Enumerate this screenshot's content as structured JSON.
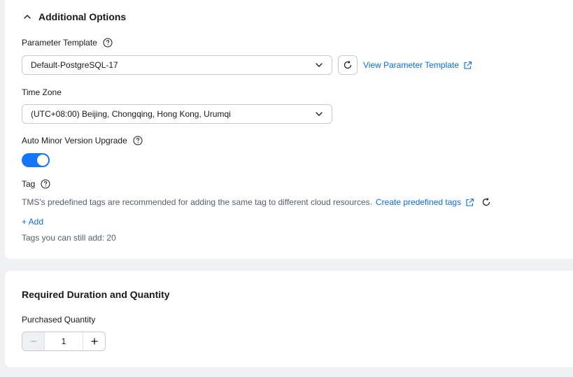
{
  "additional_options": {
    "title": "Additional Options",
    "parameter_template": {
      "label": "Parameter Template",
      "value": "Default-PostgreSQL-17",
      "view_link": "View Parameter Template"
    },
    "time_zone": {
      "label": "Time Zone",
      "value": "(UTC+08:00) Beijing, Chongqing, Hong Kong, Urumqi"
    },
    "auto_minor_upgrade": {
      "label": "Auto Minor Version Upgrade",
      "enabled": true
    },
    "tag": {
      "label": "Tag",
      "hint": "TMS's predefined tags are recommended for adding the same tag to different cloud resources.",
      "create_link": "Create predefined tags",
      "add_label": "+ Add",
      "remaining": "Tags you can still add: 20"
    }
  },
  "duration_quantity": {
    "title": "Required Duration and Quantity",
    "purchased_quantity": {
      "label": "Purchased Quantity",
      "value": "1"
    }
  },
  "colors": {
    "accent": "#1476ff",
    "link": "#0a6ed9",
    "border": "#c7c9cd",
    "background": "#f0f1f3"
  },
  "icons": [
    "chevron-up-icon",
    "help-icon",
    "chevron-down-icon",
    "refresh-icon",
    "external-link-icon",
    "minus-icon",
    "plus-icon"
  ]
}
